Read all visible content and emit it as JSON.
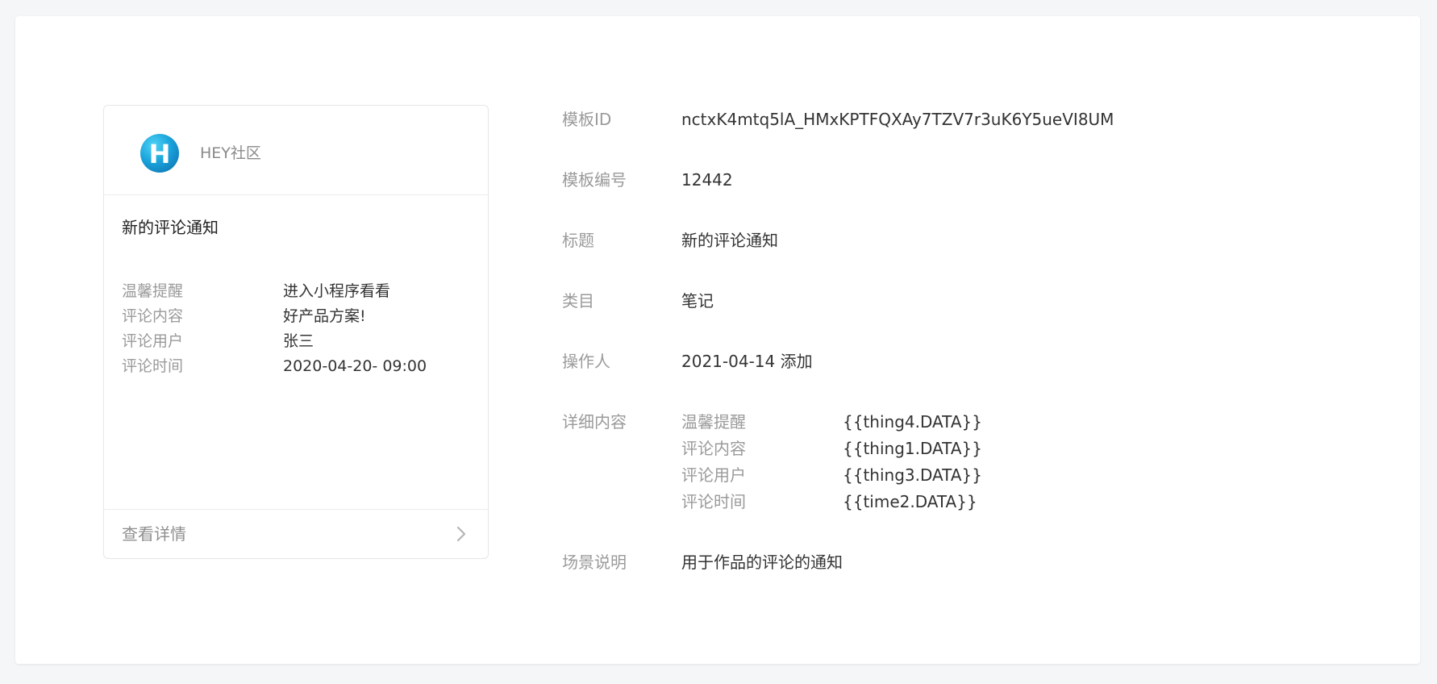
{
  "preview": {
    "app_name": "HEY社区",
    "avatar_letter": "H",
    "title": "新的评论通知",
    "fields": [
      {
        "label": "温馨提醒",
        "value": "进入小程序看看"
      },
      {
        "label": "评论内容",
        "value": "好产品方案!"
      },
      {
        "label": "评论用户",
        "value": "张三"
      },
      {
        "label": "评论时间",
        "value": "2020-04-20- 09:00"
      }
    ],
    "footer_label": "查看详情"
  },
  "info": {
    "template_id": {
      "label": "模板ID",
      "value": "nctxK4mtq5lA_HMxKPTFQXAy7TZV7r3uK6Y5ueVI8UM"
    },
    "template_number": {
      "label": "模板编号",
      "value": "12442"
    },
    "title": {
      "label": "标题",
      "value": "新的评论通知"
    },
    "category": {
      "label": "类目",
      "value": "笔记"
    },
    "operator": {
      "label": "操作人",
      "value": "2021-04-14 添加"
    },
    "detail": {
      "label": "详细内容",
      "items": [
        {
          "key": "温馨提醒",
          "value": "{{thing4.DATA}}"
        },
        {
          "key": "评论内容",
          "value": "{{thing1.DATA}}"
        },
        {
          "key": "评论用户",
          "value": "{{thing3.DATA}}"
        },
        {
          "key": "评论时间",
          "value": "{{time2.DATA}}"
        }
      ]
    },
    "scene": {
      "label": "场景说明",
      "value": "用于作品的评论的通知"
    }
  }
}
